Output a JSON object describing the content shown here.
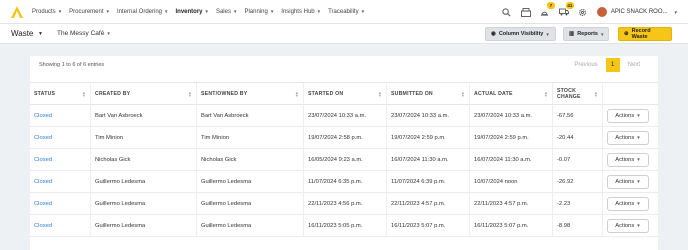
{
  "nav": {
    "items": [
      {
        "label": "Products"
      },
      {
        "label": "Procurement"
      },
      {
        "label": "Internal Ordering"
      },
      {
        "label": "Inventory"
      },
      {
        "label": "Sales"
      },
      {
        "label": "Planning"
      },
      {
        "label": "Insights Hub"
      },
      {
        "label": "Traceability"
      }
    ],
    "badges": {
      "box": "7",
      "truck": "41"
    },
    "user_name": "APIC SNACK ROO..."
  },
  "toolbar": {
    "title": "Waste",
    "venue": "The Messy Café",
    "column_visibility": "Column Visibility",
    "reports": "Reports",
    "record_waste": "Record Waste"
  },
  "table_info": {
    "entries": "Showing 1 to 6 of 6 entries",
    "previous": "Previous",
    "page": "1",
    "next": "Next"
  },
  "table": {
    "headers": [
      "STATUS",
      "CREATED BY",
      "SENT/OWNED BY",
      "STARTED ON",
      "SUBMITTED ON",
      "ACTUAL DATE",
      "STOCK CHANGE"
    ],
    "action_label": "Actions",
    "rows": [
      {
        "status": "Closed",
        "created_by": "Bart Van Asbroeck",
        "owned_by": "Bart Van Asbroeck",
        "started": "23/07/2024 10:33 a.m.",
        "submitted": "23/07/2024 10:33 a.m.",
        "actual": "23/07/2024 10:33 a.m.",
        "change": "-67.56"
      },
      {
        "status": "Closed",
        "created_by": "Tim Minion",
        "owned_by": "Tim Minion",
        "started": "19/07/2024 2:58 p.m.",
        "submitted": "19/07/2024 2:59 p.m.",
        "actual": "19/07/2024 2:59 p.m.",
        "change": "-20.44"
      },
      {
        "status": "Closed",
        "created_by": "Nicholas Gick",
        "owned_by": "Nicholas Gick",
        "started": "16/05/2024 9:23 a.m.",
        "submitted": "16/07/2024 11:30 a.m.",
        "actual": "16/07/2024 11:30 a.m.",
        "change": "-0.07"
      },
      {
        "status": "Closed",
        "created_by": "Guillermo Ledesma",
        "owned_by": "Guillermo Ledesma",
        "started": "11/07/2024 6:35 p.m.",
        "submitted": "11/07/2024 6:39 p.m.",
        "actual": "10/07/2024 noon",
        "change": "-26.92"
      },
      {
        "status": "Closed",
        "created_by": "Guillermo Ledesma",
        "owned_by": "Guillermo Ledesma",
        "started": "22/11/2023 4:56 p.m.",
        "submitted": "22/11/2023 4:57 p.m.",
        "actual": "22/11/2023 4:57 p.m.",
        "change": "-2.23"
      },
      {
        "status": "Closed",
        "created_by": "Guillermo Ledesma",
        "owned_by": "Guillermo Ledesma",
        "started": "16/11/2023 5:05 p.m.",
        "submitted": "16/11/2023 5:07 p.m.",
        "actual": "16/11/2023 5:07 p.m.",
        "change": "-8.98"
      }
    ]
  },
  "colors": {
    "accent": "#f5c518",
    "link": "#2a7fd4"
  }
}
